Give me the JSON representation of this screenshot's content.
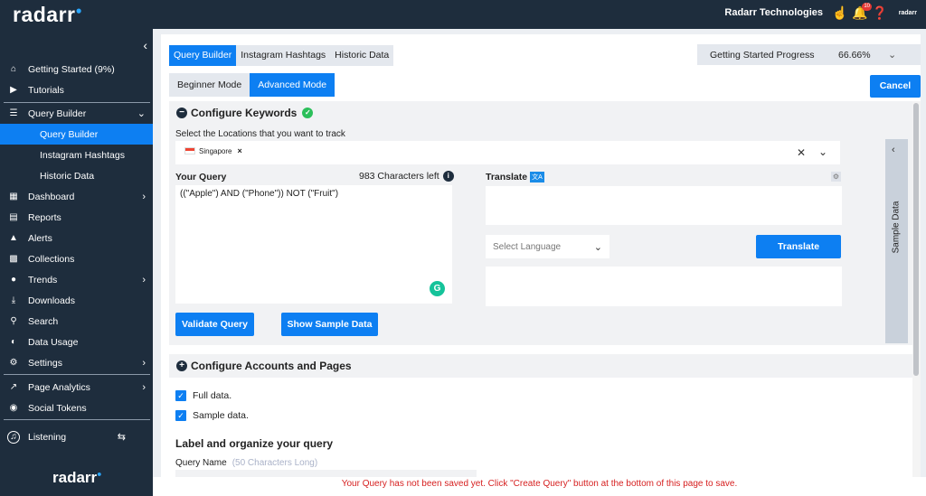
{
  "brand": "radarr",
  "topbar": {
    "company": "Radarr Technologies",
    "notification_count": "10",
    "small_logo": "radarr"
  },
  "sidebar": {
    "items": [
      {
        "label": "Getting Started (9%)",
        "icon": "home-icon"
      },
      {
        "label": "Tutorials",
        "icon": "video-icon"
      },
      {
        "label": "Query Builder",
        "icon": "database-icon"
      },
      {
        "label": "Query Builder"
      },
      {
        "label": "Instagram Hashtags"
      },
      {
        "label": "Historic Data"
      },
      {
        "label": "Dashboard",
        "icon": "grid-icon"
      },
      {
        "label": "Reports",
        "icon": "document-icon"
      },
      {
        "label": "Alerts",
        "icon": "warning-icon"
      },
      {
        "label": "Collections",
        "icon": "collections-icon"
      },
      {
        "label": "Trends",
        "icon": "flame-icon"
      },
      {
        "label": "Downloads",
        "icon": "download-icon"
      },
      {
        "label": "Search",
        "icon": "search-icon"
      },
      {
        "label": "Data Usage",
        "icon": "gauge-icon"
      },
      {
        "label": "Settings",
        "icon": "gear-icon"
      },
      {
        "label": "Page Analytics",
        "icon": "analytics-icon"
      },
      {
        "label": "Social Tokens",
        "icon": "token-icon"
      },
      {
        "label": "Listening",
        "icon": "listening-icon"
      }
    ],
    "bottom_logo": "radarr"
  },
  "tabs": [
    "Query Builder",
    "Instagram Hashtags",
    "Historic Data"
  ],
  "modes": [
    "Beginner Mode",
    "Advanced Mode"
  ],
  "progress": {
    "label": "Getting Started Progress",
    "value": "66.66%"
  },
  "cancel_label": "Cancel",
  "keywords": {
    "title": "Configure Keywords",
    "location_label": "Select the Locations that you want to track",
    "location_chip": "Singapore",
    "query_label": "Your Query",
    "chars_left": "983 Characters left",
    "query_text": "((\"Apple\") AND (\"Phone\")) NOT  (\"Fruit\")",
    "translate_label": "Translate",
    "translate_badge": "文A",
    "language_placeholder": "Select Language",
    "translate_button": "Translate",
    "validate_button": "Validate Query",
    "sample_button": "Show Sample Data",
    "sample_panel": "Sample Data"
  },
  "accounts": {
    "title": "Configure Accounts and Pages",
    "full_data": "Full data.",
    "sample_data": "Sample data."
  },
  "organize": {
    "title": "Label and organize your query",
    "name_label": "Query Name",
    "name_hint": "(50 Characters Long)"
  },
  "footer_warning": "Your Query has not been saved yet. Click \"Create Query\" button at the bottom of this page to save.",
  "colors": {
    "accent": "#0d7ff2",
    "sidebar": "#1e2d3d",
    "warning": "#d61f1f"
  }
}
